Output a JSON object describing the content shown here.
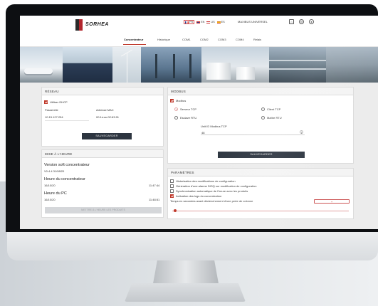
{
  "header": {
    "logo_text": "SORHEA",
    "languages": [
      {
        "code": "FR",
        "label": "FR",
        "active": true
      },
      {
        "code": "EN",
        "label": "EN",
        "active": false
      },
      {
        "code": "US",
        "label": "US",
        "active": false
      },
      {
        "code": "ES",
        "label": "ES",
        "active": false
      }
    ],
    "mode_label": "MAXIBUS UNIVERSEL"
  },
  "nav": {
    "tabs": [
      "Concentrateur",
      "Historique",
      "COM1",
      "COM2",
      "COM3",
      "COM4",
      "Relais"
    ],
    "active": "Concentrateur"
  },
  "reseau": {
    "title": "RÉSEAU",
    "dhcp_label": "Utiliser DHCP",
    "gateway_label": "Passerelle",
    "gateway_value": "10.15.127.254",
    "mac_label": "Adresse MAC",
    "mac_value": "00:1e:ac:02:63:91",
    "save_label": "SAUVEGARDER"
  },
  "mise_a_heure": {
    "title": "MISE À L'HEURE",
    "version_label": "Version soft concentrateur",
    "version_value": "V0.4.4 31/08/20",
    "conc_time_label": "Heure du concentrateur",
    "conc_date": "16/10/20",
    "conc_time": "11:47:44",
    "pc_time_label": "Heure du PC",
    "pc_date": "16/10/20",
    "pc_time": "11:48:51",
    "sync_button_label": "METTRE À L'HEURE LES PRODUITS"
  },
  "modbus": {
    "title": "MODBUS",
    "enable_label": "Modbus",
    "options": [
      {
        "label": "Serveur TCP",
        "selected": true
      },
      {
        "label": "Client TCP",
        "selected": false
      },
      {
        "label": "Esclave RTU",
        "selected": false
      },
      {
        "label": "Maître RTU",
        "selected": false
      }
    ],
    "unit_id_label": "Unit ID Modbus TCP",
    "unit_id_value": "48",
    "save_label": "SAUVEGARDER"
  },
  "parametres": {
    "title": "PARAMÈTRES",
    "checks": [
      {
        "label": "Historisation des modifications de configuration",
        "checked": false
      },
      {
        "label": "Génération d'une alarme DISQ sur modification de configuration",
        "checked": false
      },
      {
        "label": "Synchronisation automatique de l'heure avec les produits",
        "checked": false
      },
      {
        "label": "Activation des logs du concentrateur",
        "checked": true
      }
    ],
    "delay_label": "Temps en secondes avant déclenchement d'une perte de colonne",
    "delay_button": "+"
  }
}
